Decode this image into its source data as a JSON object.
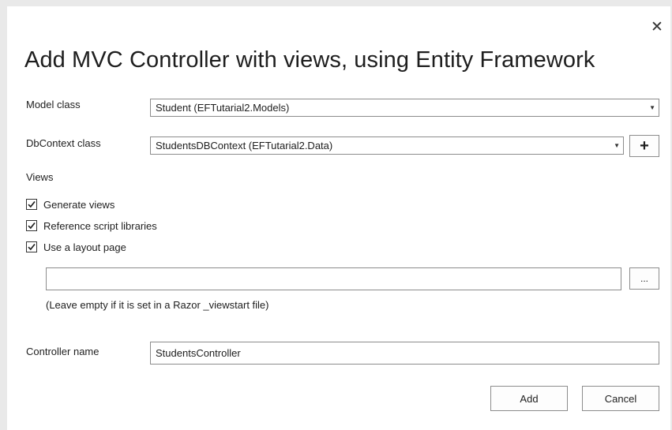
{
  "dialog": {
    "title": "Add MVC Controller with views, using Entity Framework",
    "close_glyph": "✕"
  },
  "model_class": {
    "label": "Model class",
    "value": "Student (EFTutarial2.Models)"
  },
  "dbcontext_class": {
    "label": "DbContext class",
    "value": "StudentsDBContext (EFTutarial2.Data)",
    "add_label": "+"
  },
  "views": {
    "section_label": "Views",
    "options": [
      {
        "label": "Generate views",
        "checked": true
      },
      {
        "label": "Reference script libraries",
        "checked": true
      },
      {
        "label": "Use a layout page",
        "checked": true
      }
    ],
    "layout_page_value": "",
    "browse_label": "...",
    "hint": "(Leave empty if it is set in a Razor _viewstart file)"
  },
  "controller": {
    "label": "Controller name",
    "value": "StudentsController"
  },
  "buttons": {
    "add": "Add",
    "cancel": "Cancel"
  },
  "icons": {
    "dropdown": "chevron-down-icon",
    "check": "checkmark-icon",
    "close": "close-icon"
  }
}
